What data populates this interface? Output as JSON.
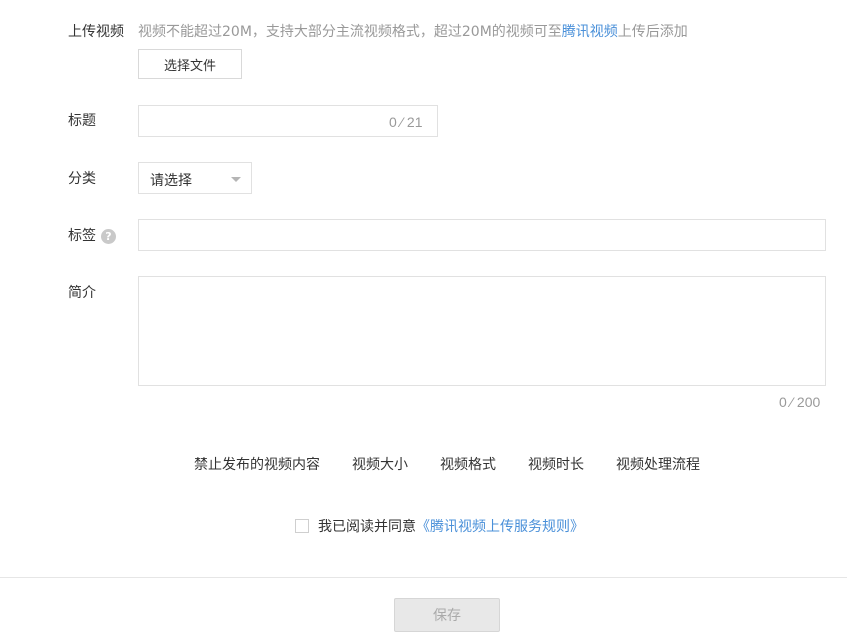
{
  "upload": {
    "label": "上传视频",
    "hint_prefix": "视频不能超过20M，支持大部分主流视频格式，超过20M的视频可至",
    "hint_link": "腾讯视频",
    "hint_suffix": "上传后添加",
    "choose_file": "选择文件"
  },
  "title": {
    "label": "标题",
    "counter": "0 ⁄ 21",
    "value": ""
  },
  "category": {
    "label": "分类",
    "selected": "请选择"
  },
  "tags": {
    "label": "标签",
    "help_glyph": "?",
    "value": ""
  },
  "intro": {
    "label": "简介",
    "counter": "0 ⁄ 200",
    "value": ""
  },
  "rules_links": [
    "禁止发布的视频内容",
    "视频大小",
    "视频格式",
    "视频时长",
    "视频处理流程"
  ],
  "agreement": {
    "prefix": "我已阅读并同意",
    "link": "《腾讯视频上传服务规则》",
    "checked": false
  },
  "save_label": "保存",
  "colors": {
    "link": "#4a90d9",
    "muted": "#999999",
    "border": "#e1e1e1"
  }
}
